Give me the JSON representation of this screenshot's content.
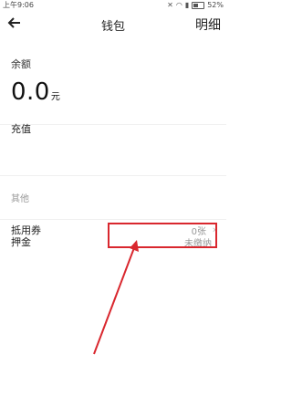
{
  "status_bar": {
    "time": "上午9:06",
    "battery": "52%"
  },
  "header": {
    "title": "钱包",
    "detail_link": "明细"
  },
  "balance": {
    "label": "余额",
    "amount": "0.0",
    "unit": "元"
  },
  "recharge": {
    "label": "充值"
  },
  "other_section": {
    "label": "其他"
  },
  "voucher": {
    "label": "抵用券",
    "value": "0张"
  },
  "deposit": {
    "label": "押金",
    "value": "未缴纳"
  },
  "colors": {
    "annotation": "#d9272e"
  }
}
